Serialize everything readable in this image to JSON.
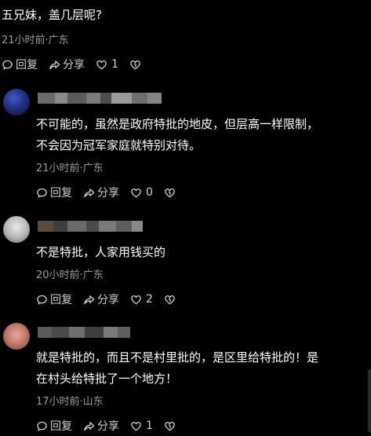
{
  "comments": [
    {
      "text_lines": [
        "五兄妹，盖几层呢?"
      ],
      "meta": "21小时前·广东",
      "reply_label": "回复",
      "share_label": "分享",
      "like_count": "1"
    },
    {
      "text_lines": [
        "不可能的，虽然是政府特批的地皮，但层高一样限制，",
        "不会因为冠军家庭就特别对待。"
      ],
      "meta": "21小时前·广东",
      "reply_label": "回复",
      "share_label": "分享",
      "like_count": "0"
    },
    {
      "text_lines": [
        "不是特批，人家用钱买的"
      ],
      "meta": "20小时前·广东",
      "reply_label": "回复",
      "share_label": "分享",
      "like_count": "2"
    },
    {
      "text_lines": [
        "就是特批的，而且不是村里批的，是区里给特批的！是",
        "在村头给特批了一个地方！"
      ],
      "meta": "17小时前·山东",
      "reply_label": "回复",
      "share_label": "分享",
      "like_count": "1"
    }
  ],
  "icons": {
    "reply": "reply-bubble-icon",
    "share": "share-arrow-icon",
    "like": "heart-icon",
    "dislike": "broken-heart-icon"
  },
  "colors": {
    "background": "#000000",
    "text": "#ffffff",
    "meta": "#9a9a9a",
    "action": "#cfcfcf"
  }
}
